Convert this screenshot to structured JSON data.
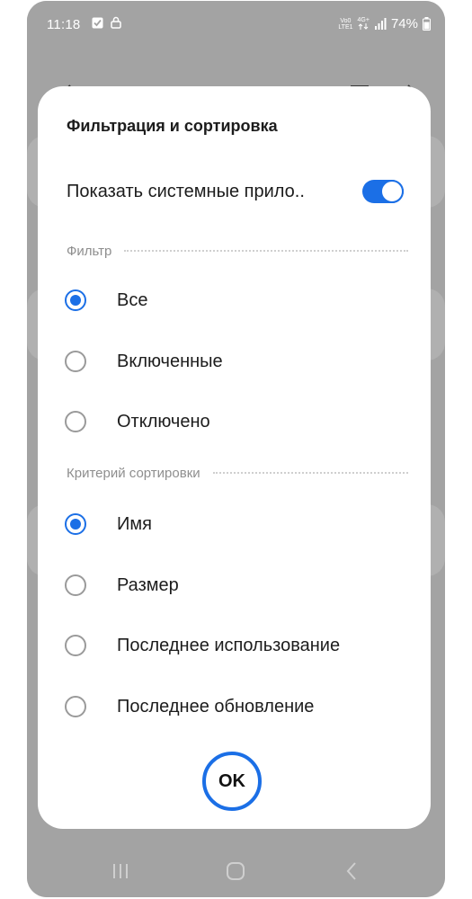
{
  "status_bar": {
    "time": "11:18",
    "network_top": "Vo0",
    "network_bottom": "LTE1",
    "network_type": "4G+",
    "battery": "74%"
  },
  "dialog": {
    "title": "Фильтрация и сортировка",
    "toggle": {
      "label": "Показать системные прило..",
      "on": true
    },
    "filter": {
      "header": "Фильтр",
      "options": [
        {
          "label": "Все",
          "checked": true
        },
        {
          "label": "Включенные",
          "checked": false
        },
        {
          "label": "Отключено",
          "checked": false
        }
      ]
    },
    "sort": {
      "header": "Критерий сортировки",
      "options": [
        {
          "label": "Имя",
          "checked": true
        },
        {
          "label": "Размер",
          "checked": false
        },
        {
          "label": "Последнее использование",
          "checked": false
        },
        {
          "label": "Последнее обновление",
          "checked": false
        }
      ]
    },
    "ok_label": "OK"
  },
  "colors": {
    "accent": "#1b6fe6",
    "dim_background": "#a3a3a3",
    "dialog_background": "#ffffff"
  }
}
